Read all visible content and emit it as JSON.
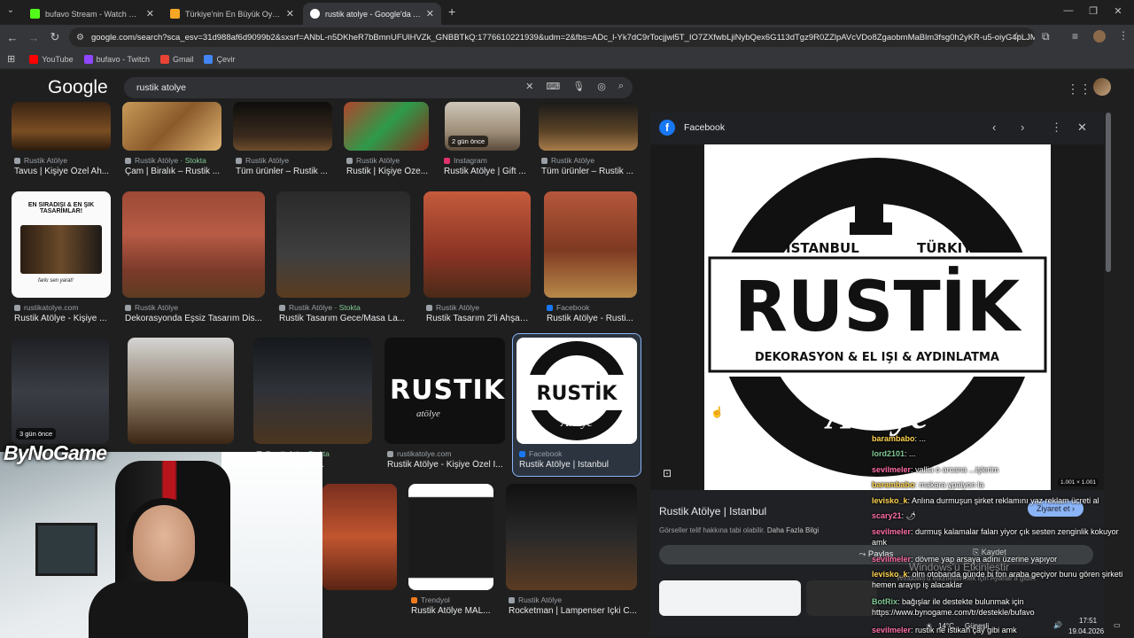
{
  "browser": {
    "tabs": [
      {
        "title": "bufavo Stream - Watch Live on",
        "fav_color": "#53fc18"
      },
      {
        "title": "Türkiye'nin En Büyük Oyuncu D",
        "fav_color": "#f5a623"
      },
      {
        "title": "rustik atolye - Google'da Ara",
        "fav_color": "#ffffff"
      }
    ],
    "new_tab": "+",
    "url": "google.com/search?sca_esv=31d988af6d9099b2&sxsrf=ANbL-n5DKheR7bBmnUFUlHVZk_GNBBTkQ:1776610221939&udm=2&fbs=ADc_l-Yk7dC9rTocjjwl5T_IO7ZXfwbLjiNybQex6G113dTgz9R0ZZlpAVcVDo8ZgaobmMaBlm3fsg0h2yKR-u5-oiyG4pLJM...",
    "bookmarks": [
      {
        "label": "YouTube",
        "color": "#ff0000"
      },
      {
        "label": "bufavo - Twitch",
        "color": "#9146ff"
      },
      {
        "label": "Gmail",
        "color": "#ea4335"
      },
      {
        "label": "Çevir",
        "color": "#4285f4"
      }
    ]
  },
  "google": {
    "logo": "Google",
    "query": "rustik atolye"
  },
  "results": {
    "row1": [
      {
        "source": "Rustik Atölye",
        "caption": "Tavus | Kişiye Özel Ah..."
      },
      {
        "source": "Rustik Atölye",
        "stock": "· Stokta",
        "caption": "Çam | Biralık – Rustik ..."
      },
      {
        "source": "Rustik Atölye",
        "caption": "Tüm ürünler – Rustik ..."
      },
      {
        "source": "Rustik Atölye",
        "caption": "Rustik | Kişiye Öze..."
      },
      {
        "source": "Instagram",
        "caption": "Rustik Atölye | Gift ...",
        "badge": "2 gün önce"
      },
      {
        "source": "Rustik Atölye",
        "caption": "Tüm ürünler – Rustik ..."
      }
    ],
    "row2": [
      {
        "source": "rustikatolye.com",
        "caption": "Rustik Atölye - Kişiye ...",
        "poster_text": "EN SIRADIŞI & EN ŞIK TASARIMLAR!",
        "poster_tag": "farkı sen yarat!"
      },
      {
        "source": "Rustik Atölye",
        "caption": "Dekorasyonda Eşsiz Tasarım Dis..."
      },
      {
        "source": "Rustik Atölye",
        "stock": "· Stokta",
        "caption": "Rustik Tasarım Gece/Masa La..."
      },
      {
        "source": "Rustik Atölye",
        "caption": "Rustik Tasarım 2'li Ahşap ..."
      },
      {
        "source": "Facebook",
        "caption": "Rustik Atölye - Rusti..."
      }
    ],
    "row3": [
      {
        "caption": "",
        "badge": "3 gün önce"
      },
      {
        "caption": ""
      },
      {
        "source": "Rustik Atö...",
        "stock": "Stokta",
        "caption": "...ampenser İçk..."
      },
      {
        "source": "rustikatolye.com",
        "caption": "Rustik Atölye - Kişiye Özel I...",
        "logo_text": "RUSTIK",
        "logo_sub": "atölye"
      },
      {
        "source": "Facebook",
        "caption": "Rustik Atölye | Istanbul"
      }
    ],
    "row4": [
      {
        "caption": ""
      },
      {
        "source": "Trendyol",
        "caption": "Rustik Atölye MAL..."
      },
      {
        "source": "Rustik Atölye",
        "caption": "Rocketman | Lampenser İçki C..."
      }
    ]
  },
  "side_panel": {
    "source": "Facebook",
    "logo": {
      "top_left": "ISTANBUL",
      "top_right": "TÜRKIYE",
      "main": "RUSTİK",
      "sub": "DEKORASYON & EL IŞI & AYDINLATMA",
      "script": "Atölye"
    },
    "dimensions": "1.001 × 1.001",
    "title": "Rustik Atölye | Istanbul",
    "note": "Görseller telif hakkına tabi olabilir.",
    "more": "Daha Fazla Bilgi",
    "visit": "Ziyaret et",
    "share": "Paylaş",
    "save": "Kaydet"
  },
  "overlay": {
    "brand": "ByNoGame",
    "windows_activation_1": "Windows'u Etkinleştir",
    "windows_activation_2": "Windows'u etkinleştirmek için Ayarlar'a gidin."
  },
  "chat": [
    {
      "user": "barambabo",
      "text": ": ...",
      "color": "y"
    },
    {
      "user": "lord2101",
      "text": ": ...",
      "color": "g"
    },
    {
      "user": "sevilmeler",
      "text": ": vallia o arcana ...işlerim",
      "color": "p"
    },
    {
      "user": "barambabo",
      "text": ": makara ypaiyon la",
      "color": "y"
    },
    {
      "user": "levisko_k",
      "text": ": Anlına durmuşun şirket reklamını yaz reklam ücreti al",
      "color": "y"
    },
    {
      "user": "scary21",
      "text": ": 🌶",
      "color": "p"
    },
    {
      "user": "sevilmeler",
      "text": ": durmuş kalamalar falan yiyor çık sesten zenginlik kokuyor amk",
      "color": "p"
    },
    {
      "user": "sevilmeler",
      "text": ": dövme yap arsaya adını üzerine yapıyor",
      "color": "p"
    },
    {
      "user": "levisko_k",
      "text": ": olm otobanda günde bi ton araba geçiyor bunu gören şirketi hemen arayıp iş alacaklar",
      "color": "y"
    },
    {
      "user": "BotRix",
      "text": ": bağışlar ile destekte bulunmak için https://www.bynogame.com/tr/destekle/bufavo",
      "color": "g"
    },
    {
      "user": "sevilmeler",
      "text": ": rustik ne istikan çay gibi amk",
      "color": "p"
    }
  ],
  "taskbar": {
    "temp": "14°C",
    "weather": "Güneşli",
    "time": "17:51",
    "date": "19.04.2026"
  }
}
